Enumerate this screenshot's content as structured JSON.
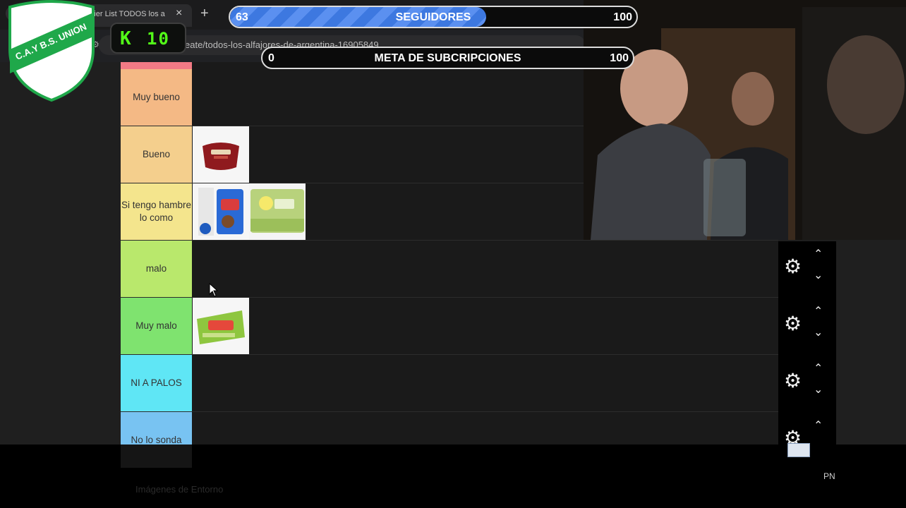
{
  "browser": {
    "tab_title": "a Tier List TODOS los a",
    "tab_close": "×",
    "new_tab": "+",
    "address_url": "eate/todos-los-alfajores-de-argentina-16905849"
  },
  "overlay": {
    "followers": {
      "current": "63",
      "label": "SEGUIDORES",
      "goal": "100",
      "progress": 0.63
    },
    "subs": {
      "current": "0",
      "label": "META DE SUBCRIPCIONES",
      "goal": "100",
      "progress": 0.0
    },
    "kick": {
      "logo": "K",
      "count": "10"
    },
    "shield": {
      "text": "C.A.Y B.S. UNION",
      "color": "#1fa84a"
    }
  },
  "tiers": [
    {
      "label": "Muy bueno",
      "color": "#f4b985"
    },
    {
      "label": "Bueno",
      "color": "#f4cf8d"
    },
    {
      "label": "Si tengo hambre lo como",
      "color": "#f4e58d"
    },
    {
      "label": "malo",
      "color": "#b9e86c"
    },
    {
      "label": "Muy malo",
      "color": "#7fe36f"
    },
    {
      "label": "NI A PALOS",
      "color": "#5fe6f5"
    },
    {
      "label": "No lo sonda",
      "color": "#78c3f2"
    }
  ],
  "controls": {
    "gear_icon": "⚙",
    "up_icon": "⌃",
    "down_icon": "⌄"
  },
  "footer": {
    "pn": "PN",
    "section": "Imágenes de Entorno"
  },
  "colors": {
    "top_strip": "#f27a85"
  }
}
